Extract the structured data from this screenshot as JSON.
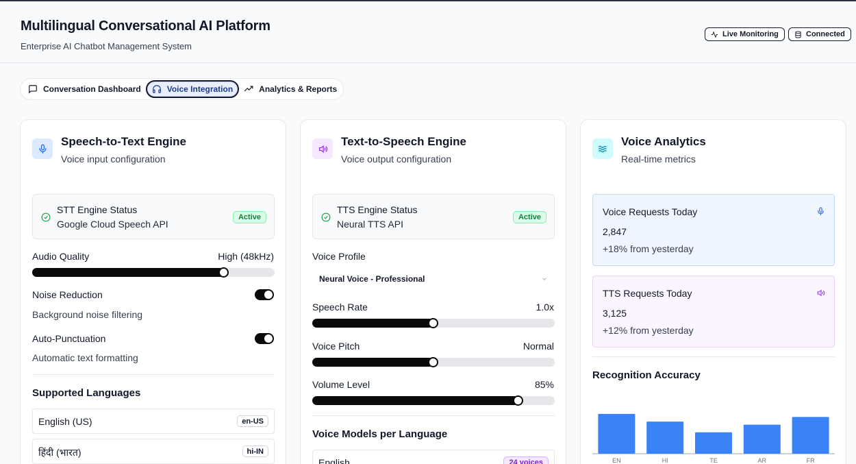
{
  "header": {
    "title": "Multilingual Conversational AI Platform",
    "subtitle": "Enterprise AI Chatbot Management System",
    "live_badge": "Live Monitoring",
    "connected_badge": "Connected"
  },
  "tabs": [
    {
      "label": "Conversation Dashboard",
      "icon": "message-square-icon",
      "active": false
    },
    {
      "label": "Voice Integration",
      "icon": "headphones-icon",
      "active": true
    },
    {
      "label": "Analytics & Reports",
      "icon": "trending-up-icon",
      "active": false
    }
  ],
  "stt": {
    "title": "Speech-to-Text Engine",
    "subtitle": "Voice input configuration",
    "status_title": "STT Engine Status",
    "status_api": "Google Cloud Speech API",
    "status_badge": "Active",
    "audio_quality_label": "Audio Quality",
    "audio_quality_value": "High (48kHz)",
    "audio_quality_level": 0.79,
    "noise_label": "Noise Reduction",
    "noise_desc": "Background noise filtering",
    "noise_on": true,
    "punct_label": "Auto-Punctuation",
    "punct_desc": "Automatic text formatting",
    "punct_on": true,
    "languages_title": "Supported Languages",
    "languages": [
      {
        "name": "English (US)",
        "code": "en-US"
      },
      {
        "name": "हिंदी (भारत)",
        "code": "hi-IN"
      }
    ]
  },
  "tts": {
    "title": "Text-to-Speech Engine",
    "subtitle": "Voice output configuration",
    "status_title": "TTS Engine Status",
    "status_api": "Neural TTS API",
    "status_badge": "Active",
    "voice_profile_label": "Voice Profile",
    "voice_profile_value": "Neural Voice - Professional",
    "speech_rate_label": "Speech Rate",
    "speech_rate_value": "1.0x",
    "speech_rate_level": 0.5,
    "pitch_label": "Voice Pitch",
    "pitch_value": "Normal",
    "pitch_level": 0.5,
    "volume_label": "Volume Level",
    "volume_value": "85%",
    "volume_level": 0.85,
    "models_title": "Voice Models per Language",
    "models": [
      {
        "language": "English",
        "voices": "24 voices"
      }
    ]
  },
  "analytics": {
    "title": "Voice Analytics",
    "subtitle": "Real-time metrics",
    "voice_requests_title": "Voice Requests Today",
    "voice_requests_value": "2,847",
    "voice_requests_delta": "+18% from yesterday",
    "tts_requests_title": "TTS Requests Today",
    "tts_requests_value": "3,125",
    "tts_requests_delta": "+12% from yesterday",
    "accuracy_title": "Recognition Accuracy"
  },
  "colors": {
    "bar": "#3b82f6",
    "active_green": "#15803d",
    "purple": "#7e22ce"
  },
  "chart_data": {
    "type": "bar",
    "categories": [
      "EN",
      "HI",
      "TE",
      "AR",
      "FR"
    ],
    "values": [
      96,
      91,
      84,
      89,
      94
    ],
    "ylim": [
      70,
      100
    ],
    "title": "Recognition Accuracy",
    "xlabel": "",
    "ylabel": ""
  }
}
